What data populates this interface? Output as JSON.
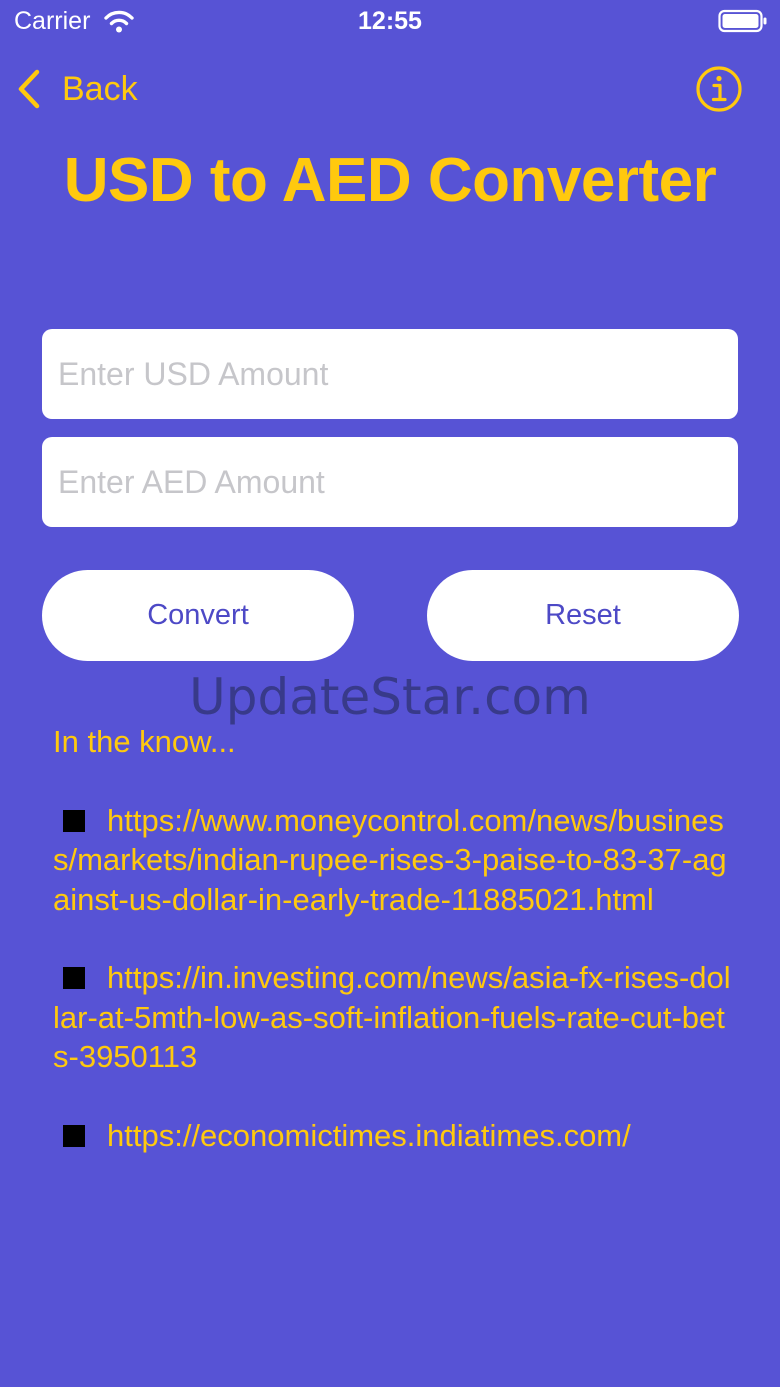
{
  "status_bar": {
    "carrier": "Carrier",
    "time": "12:55"
  },
  "nav": {
    "back_label": "Back",
    "info_icon": "info-circle-icon"
  },
  "title": "USD to AED Converter",
  "inputs": {
    "usd": {
      "value": "",
      "placeholder": "Enter USD Amount"
    },
    "aed": {
      "value": "",
      "placeholder": "Enter AED Amount"
    }
  },
  "buttons": {
    "convert": "Convert",
    "reset": "Reset"
  },
  "watermark": "UpdateStar.com",
  "news": {
    "heading": "In the know...",
    "items": [
      {
        "url": "https://www.moneycontrol.com/news/business/markets/indian-rupee-rises-3-paise-to-83-37-against-us-dollar-in-early-trade-11885021.html"
      },
      {
        "url": "https://in.investing.com/news/asia-fx-rises-dollar-at-5mth-low-as-soft-inflation-fuels-rate-cut-bets-3950113"
      },
      {
        "url": "https://economictimes.indiatimes.com/"
      }
    ]
  },
  "colors": {
    "background": "#5753D5",
    "accent": "#FFC90E",
    "button_text": "#4D49C6",
    "field_bg": "#FFFFFF"
  }
}
